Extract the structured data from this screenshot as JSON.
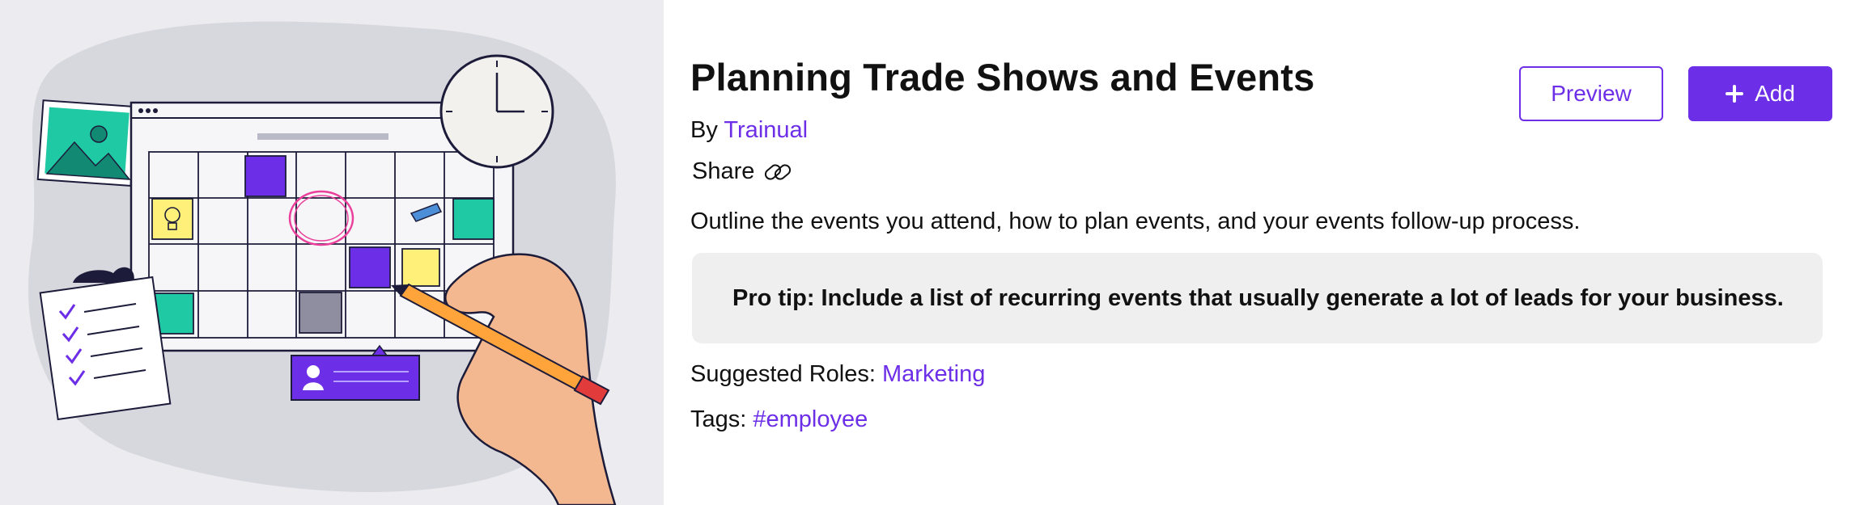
{
  "template": {
    "title": "Planning Trade Shows and Events",
    "by_label": "By",
    "author": "Trainual",
    "share_label": "Share",
    "description": "Outline the events you attend, how to plan events, and your events follow-up process.",
    "pro_tip": "Pro tip: Include a list of recurring events that usually generate a lot of leads for your business.",
    "roles_label": "Suggested Roles:",
    "role": "Marketing",
    "tags_label": "Tags:",
    "tag": "#employee"
  },
  "actions": {
    "preview_label": "Preview",
    "add_label": "Add"
  },
  "colors": {
    "accent": "#6d2ee8",
    "tip_background": "#efefef",
    "hero_background": "#ebebf0"
  },
  "icons": {
    "share": "link-icon",
    "add": "plus-icon"
  }
}
